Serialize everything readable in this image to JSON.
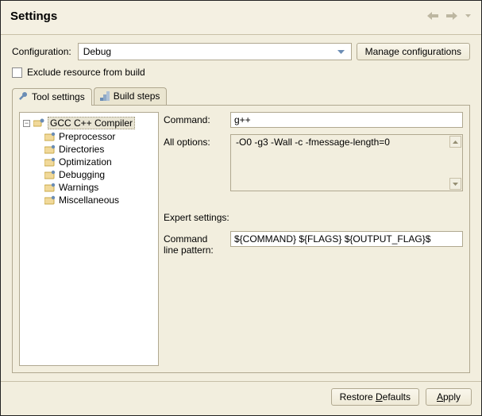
{
  "title": "Settings",
  "config": {
    "label": "Configuration:",
    "value": "Debug",
    "manage_btn": "Manage configurations"
  },
  "exclude_checkbox": {
    "label": "Exclude resource from build",
    "checked": false
  },
  "tabs": [
    {
      "id": "tool-settings",
      "label": "Tool settings",
      "active": true
    },
    {
      "id": "build-steps",
      "label": "Build steps",
      "active": false
    }
  ],
  "tree": {
    "root": {
      "label": "GCC C++ Compiler",
      "expanded": true,
      "selected": true,
      "children": [
        {
          "label": "Preprocessor"
        },
        {
          "label": "Directories"
        },
        {
          "label": "Optimization"
        },
        {
          "label": "Debugging"
        },
        {
          "label": "Warnings"
        },
        {
          "label": "Miscellaneous"
        }
      ]
    }
  },
  "form": {
    "command_label": "Command:",
    "command_value": "g++",
    "all_options_label": "All options:",
    "all_options_value": "-O0 -g3 -Wall -c -fmessage-length=0",
    "expert_title": "Expert settings:",
    "pattern_label_line1": "Command",
    "pattern_label_line2": "line pattern:",
    "pattern_value": "${COMMAND} ${FLAGS} ${OUTPUT_FLAG}$"
  },
  "footer": {
    "restore": "Restore Defaults",
    "apply": "Apply"
  }
}
